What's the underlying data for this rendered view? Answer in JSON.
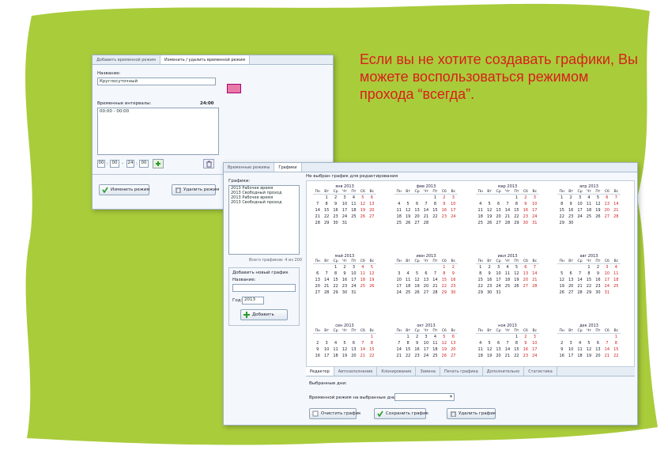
{
  "callout": {
    "text": "Если вы не хотите создавать графики, Вы можете воспользоваться режимом прохода “всегда”."
  },
  "win1": {
    "tabs": [
      "Добавить временной режим",
      "Изменить / удалить временной режим"
    ],
    "name_label": "Название:",
    "name_value": "Круглосуточный",
    "intervals_label": "Временные интервалы:",
    "intervals_total": "24:00",
    "interval_item": "00:00 - 00:00",
    "time_h1": "00",
    "time_m1": "00",
    "time_h2": "24",
    "time_m2": "00",
    "time_colon": ":",
    "time_dash": "-",
    "btn_change": "Изменить режим",
    "btn_delete": "Удалить режим",
    "color_swatch": "#e87aa8"
  },
  "win2": {
    "tabs": [
      "Временные режимы",
      "Графики"
    ],
    "header_note": "Не выбран график для редактирования",
    "schedules_label": "Графики:",
    "schedules": [
      "2013 Рабочее время",
      "2013 Свободный проход",
      "2013 Рабочее время",
      "2013 Свободный проход"
    ],
    "total": "Всего графиков: 4 из 200",
    "add_group": "Добавить новый график",
    "new_name_label": "Название:",
    "year_label": "Год:",
    "year_value": "2013",
    "btn_add": "Добавить",
    "bottom_tabs": [
      "Редактор",
      "Автозаполнение",
      "Клонирование",
      "Замена",
      "Печать графика",
      "Дополнительно",
      "Статистика"
    ],
    "selected_days": "Выбранные дни:",
    "mode_label": "Временной режим на выбранные дни:",
    "btn_clear": "Очистить график",
    "btn_save": "Сохранить график",
    "btn_remove": "Удалить график",
    "weekdays": [
      "Пн",
      "Вт",
      "Ср",
      "Чт",
      "Пт",
      "Сб",
      "Вс"
    ],
    "months": [
      {
        "title": "янв 2013",
        "weeks": [
          [
            "",
            "1",
            "2",
            "3",
            "4",
            "5",
            "6"
          ],
          [
            "7",
            "8",
            "9",
            "10",
            "11",
            "12",
            "13"
          ],
          [
            "14",
            "15",
            "16",
            "17",
            "18",
            "19",
            "20"
          ],
          [
            "21",
            "22",
            "23",
            "24",
            "25",
            "26",
            "27"
          ],
          [
            "28",
            "29",
            "30",
            "31",
            "",
            "",
            ""
          ]
        ]
      },
      {
        "title": "фев 2013",
        "weeks": [
          [
            "",
            "",
            "",
            "",
            "1",
            "2",
            "3"
          ],
          [
            "4",
            "5",
            "6",
            "7",
            "8",
            "9",
            "10"
          ],
          [
            "11",
            "12",
            "13",
            "14",
            "15",
            "16",
            "17"
          ],
          [
            "18",
            "19",
            "20",
            "21",
            "22",
            "23",
            "24"
          ],
          [
            "25",
            "26",
            "27",
            "28",
            "",
            "",
            ""
          ]
        ]
      },
      {
        "title": "мар 2013",
        "weeks": [
          [
            "",
            "",
            "",
            "",
            "1",
            "2",
            "3"
          ],
          [
            "4",
            "5",
            "6",
            "7",
            "8",
            "9",
            "10"
          ],
          [
            "11",
            "12",
            "13",
            "14",
            "15",
            "16",
            "17"
          ],
          [
            "18",
            "19",
            "20",
            "21",
            "22",
            "23",
            "24"
          ],
          [
            "25",
            "26",
            "27",
            "28",
            "29",
            "30",
            "31"
          ]
        ]
      },
      {
        "title": "апр 2013",
        "weeks": [
          [
            "1",
            "2",
            "3",
            "4",
            "5",
            "6",
            "7"
          ],
          [
            "8",
            "9",
            "10",
            "11",
            "12",
            "13",
            "14"
          ],
          [
            "15",
            "16",
            "17",
            "18",
            "19",
            "20",
            "21"
          ],
          [
            "22",
            "23",
            "24",
            "25",
            "26",
            "27",
            "28"
          ],
          [
            "29",
            "30",
            "",
            "",
            "",
            "",
            ""
          ]
        ]
      },
      {
        "title": "май 2013",
        "weeks": [
          [
            "",
            "",
            "1",
            "2",
            "3",
            "4",
            "5"
          ],
          [
            "6",
            "7",
            "8",
            "9",
            "10",
            "11",
            "12"
          ],
          [
            "13",
            "14",
            "15",
            "16",
            "17",
            "18",
            "19"
          ],
          [
            "20",
            "21",
            "22",
            "23",
            "24",
            "25",
            "26"
          ],
          [
            "27",
            "28",
            "29",
            "30",
            "31",
            "",
            ""
          ]
        ]
      },
      {
        "title": "июн 2013",
        "weeks": [
          [
            "",
            "",
            "",
            "",
            "",
            "1",
            "2"
          ],
          [
            "3",
            "4",
            "5",
            "6",
            "7",
            "8",
            "9"
          ],
          [
            "10",
            "11",
            "12",
            "13",
            "14",
            "15",
            "16"
          ],
          [
            "17",
            "18",
            "19",
            "20",
            "21",
            "22",
            "23"
          ],
          [
            "24",
            "25",
            "26",
            "27",
            "28",
            "29",
            "30"
          ]
        ]
      },
      {
        "title": "июл 2013",
        "weeks": [
          [
            "1",
            "2",
            "3",
            "4",
            "5",
            "6",
            "7"
          ],
          [
            "8",
            "9",
            "10",
            "11",
            "12",
            "13",
            "14"
          ],
          [
            "15",
            "16",
            "17",
            "18",
            "19",
            "20",
            "21"
          ],
          [
            "22",
            "23",
            "24",
            "25",
            "26",
            "27",
            "28"
          ],
          [
            "29",
            "30",
            "31",
            "",
            "",
            "",
            ""
          ]
        ]
      },
      {
        "title": "авг 2013",
        "weeks": [
          [
            "",
            "",
            "",
            "1",
            "2",
            "3",
            "4"
          ],
          [
            "5",
            "6",
            "7",
            "8",
            "9",
            "10",
            "11"
          ],
          [
            "12",
            "13",
            "14",
            "15",
            "16",
            "17",
            "18"
          ],
          [
            "19",
            "20",
            "21",
            "22",
            "23",
            "24",
            "25"
          ],
          [
            "26",
            "27",
            "28",
            "29",
            "30",
            "31",
            ""
          ]
        ]
      },
      {
        "title": "сен 2013",
        "weeks": [
          [
            "",
            "",
            "",
            "",
            "",
            "",
            "1"
          ],
          [
            "2",
            "3",
            "4",
            "5",
            "6",
            "7",
            "8"
          ],
          [
            "9",
            "10",
            "11",
            "12",
            "13",
            "14",
            "15"
          ],
          [
            "16",
            "17",
            "18",
            "19",
            "20",
            "21",
            "22"
          ]
        ]
      },
      {
        "title": "окт 2013",
        "weeks": [
          [
            "",
            "1",
            "2",
            "3",
            "4",
            "5",
            "6"
          ],
          [
            "7",
            "8",
            "9",
            "10",
            "11",
            "12",
            "13"
          ],
          [
            "14",
            "15",
            "16",
            "17",
            "18",
            "19",
            "20"
          ],
          [
            "21",
            "22",
            "23",
            "24",
            "25",
            "26",
            "27"
          ]
        ]
      },
      {
        "title": "ноя 2013",
        "weeks": [
          [
            "",
            "",
            "",
            "",
            "1",
            "2",
            "3"
          ],
          [
            "4",
            "5",
            "6",
            "7",
            "8",
            "9",
            "10"
          ],
          [
            "11",
            "12",
            "13",
            "14",
            "15",
            "16",
            "17"
          ],
          [
            "18",
            "19",
            "20",
            "21",
            "22",
            "23",
            "24"
          ]
        ]
      },
      {
        "title": "дек 2013",
        "weeks": [
          [
            "",
            "",
            "",
            "",
            "",
            "",
            "1"
          ],
          [
            "2",
            "3",
            "4",
            "5",
            "6",
            "7",
            "8"
          ],
          [
            "9",
            "10",
            "11",
            "12",
            "13",
            "14",
            "15"
          ],
          [
            "16",
            "17",
            "18",
            "19",
            "20",
            "21",
            "22"
          ]
        ]
      }
    ]
  }
}
